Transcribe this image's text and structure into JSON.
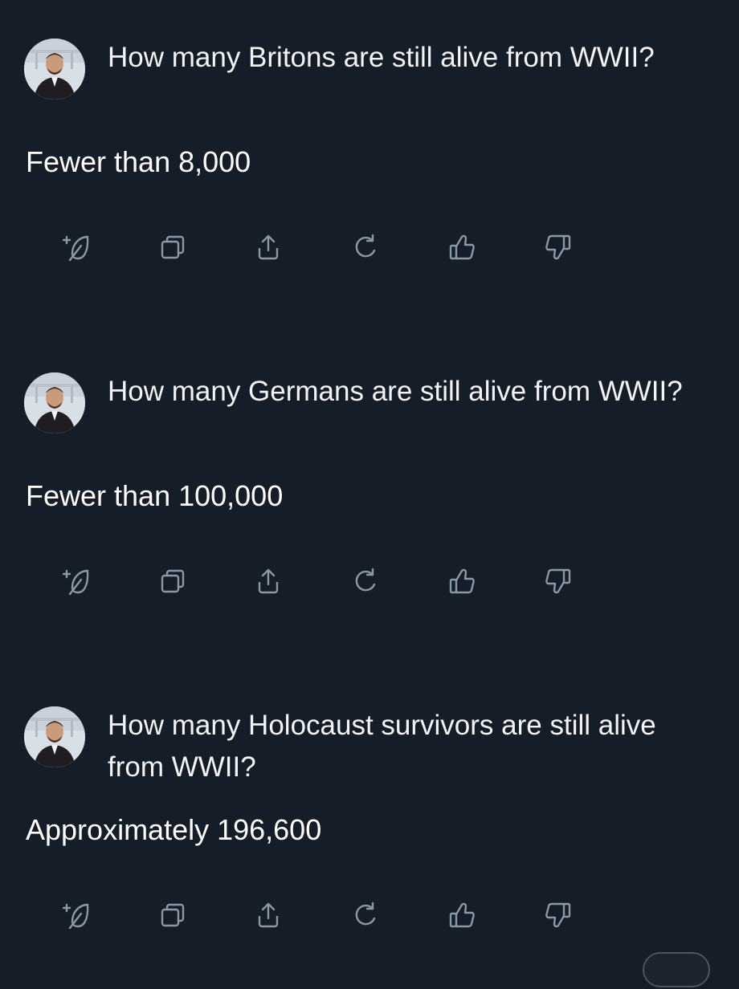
{
  "conversation": [
    {
      "question": "How many Britons are still alive from WWII?",
      "answer": "Fewer than 8,000"
    },
    {
      "question": "How many Germans are still alive from WWII?",
      "answer": "Fewer than 100,000"
    },
    {
      "question": "How many Holocaust survivors are still alive from WWII?",
      "answer": "Approximately 196,600"
    }
  ],
  "actions": [
    "regenerate-with-feather-icon",
    "copy-icon",
    "share-icon",
    "refresh-icon",
    "thumbs-up-icon",
    "thumbs-down-icon"
  ],
  "colors": {
    "background": "#151d28",
    "text": "#ffffff",
    "icon": "#8b98a5"
  }
}
